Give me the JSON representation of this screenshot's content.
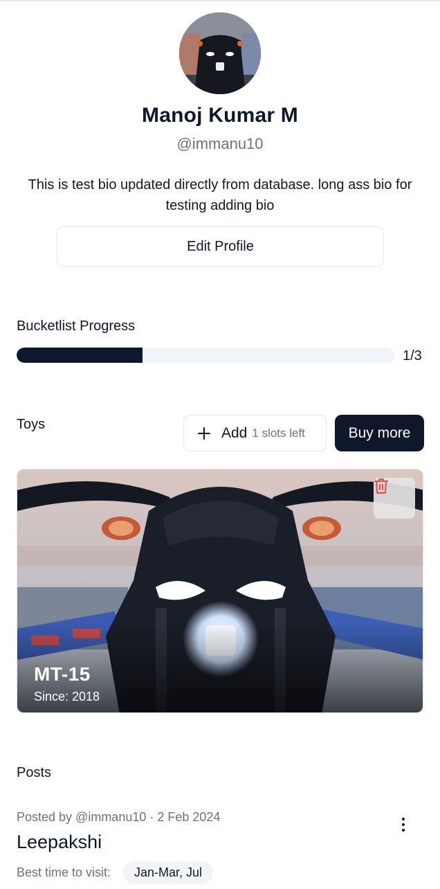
{
  "profile": {
    "name": "Manoj Kumar M",
    "handle": "@immanu10",
    "bio": "This is test bio updated directly from database. long ass bio for testing adding bio",
    "edit_label": "Edit Profile"
  },
  "bucketlist": {
    "title": "Bucketlist Progress",
    "count_label": "1/3",
    "progress_fraction": 0.333
  },
  "toys": {
    "title": "Toys",
    "add_label": "Add",
    "slots_label": "1 slots left",
    "buy_label": "Buy more",
    "items": [
      {
        "name": "MT-15",
        "since": "Since: 2018"
      }
    ]
  },
  "posts": {
    "title": "Posts",
    "items": [
      {
        "meta": "Posted by @immanu10 · 2 Feb 2024",
        "title": "Leepakshi",
        "best_time_label": "Best time to visit:",
        "best_time_value": "Jan-Mar, Jul"
      }
    ]
  },
  "colors": {
    "primary": "#0f172a",
    "muted": "#6b7280",
    "track": "#f1f5f9",
    "danger": "#ef4444"
  },
  "icons": {
    "add": "plus-icon",
    "delete": "trash-icon",
    "menu": "more-vertical-icon"
  }
}
